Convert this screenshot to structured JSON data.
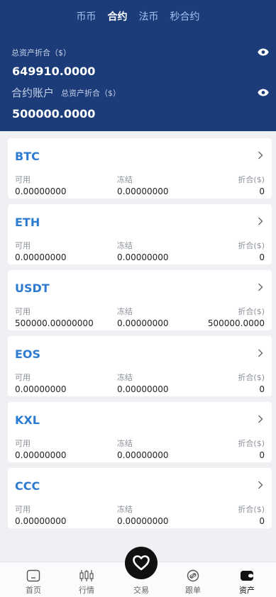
{
  "tabs": [
    {
      "label": "币币",
      "active": false
    },
    {
      "label": "合约",
      "active": true
    },
    {
      "label": "法币",
      "active": false
    },
    {
      "label": "秒合约",
      "active": false
    }
  ],
  "summary": {
    "total_label": "总资产折合（$）",
    "total_value": "649910.0000",
    "contract_title": "合约账户",
    "contract_total_label": "总资产折合（$）",
    "contract_value": "500000.0000"
  },
  "columns": {
    "available": "可用",
    "frozen": "冻结",
    "converted": "折合($)"
  },
  "assets": [
    {
      "name": "BTC",
      "available": "0.00000000",
      "frozen": "0.00000000",
      "converted": "0"
    },
    {
      "name": "ETH",
      "available": "0.00000000",
      "frozen": "0.00000000",
      "converted": "0"
    },
    {
      "name": "USDT",
      "available": "500000.00000000",
      "frozen": "0.00000000",
      "converted": "500000.0000"
    },
    {
      "name": "EOS",
      "available": "0.00000000",
      "frozen": "0.00000000",
      "converted": "0"
    },
    {
      "name": "KXL",
      "available": "0.00000000",
      "frozen": "0.00000000",
      "converted": "0"
    },
    {
      "name": "CCC",
      "available": "0.00000000",
      "frozen": "0.00000000",
      "converted": "0"
    }
  ],
  "nav": {
    "home": {
      "label": "首页",
      "icon": "home-icon"
    },
    "market": {
      "label": "行情",
      "icon": "candlestick-icon"
    },
    "trade": {
      "label": "交易",
      "icon": "heart-icon"
    },
    "follow": {
      "label": "跟单",
      "icon": "link-icon"
    },
    "assets": {
      "label": "资产",
      "icon": "wallet-icon"
    }
  },
  "colors": {
    "header": "#1b3c78",
    "accent": "#2d7ad1"
  }
}
